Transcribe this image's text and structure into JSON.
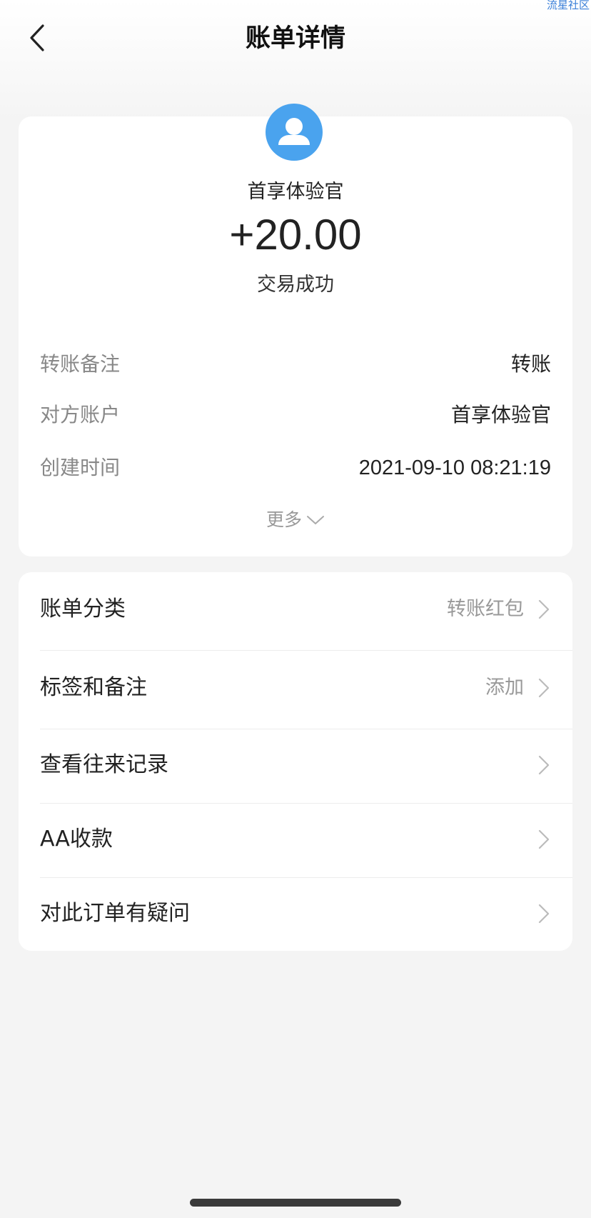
{
  "watermark": "流星社区",
  "header": {
    "back_icon": "chevron-left-icon",
    "title": "账单详情"
  },
  "summary": {
    "avatar_icon": "user-avatar-icon",
    "avatar_color": "#4aa3ee",
    "counterparty": "首享体验官",
    "amount": "+20.00",
    "status": "交易成功",
    "details": [
      {
        "label": "转账备注",
        "value": "转账"
      },
      {
        "label": "对方账户",
        "value": "首享体验官"
      },
      {
        "label": "创建时间",
        "value": "2021-09-10 08:21:19"
      }
    ],
    "more_label": "更多",
    "more_icon": "chevron-down-icon"
  },
  "menu": {
    "items": [
      {
        "label": "账单分类",
        "value": "转账红包",
        "icon": "chevron-right-icon"
      },
      {
        "label": "标签和备注",
        "value": "添加",
        "icon": "chevron-right-icon"
      },
      {
        "label": "查看往来记录",
        "value": "",
        "icon": "chevron-right-icon"
      },
      {
        "label": "AA收款",
        "value": "",
        "icon": "chevron-right-icon"
      },
      {
        "label": "对此订单有疑问",
        "value": "",
        "icon": "chevron-right-icon"
      }
    ]
  }
}
